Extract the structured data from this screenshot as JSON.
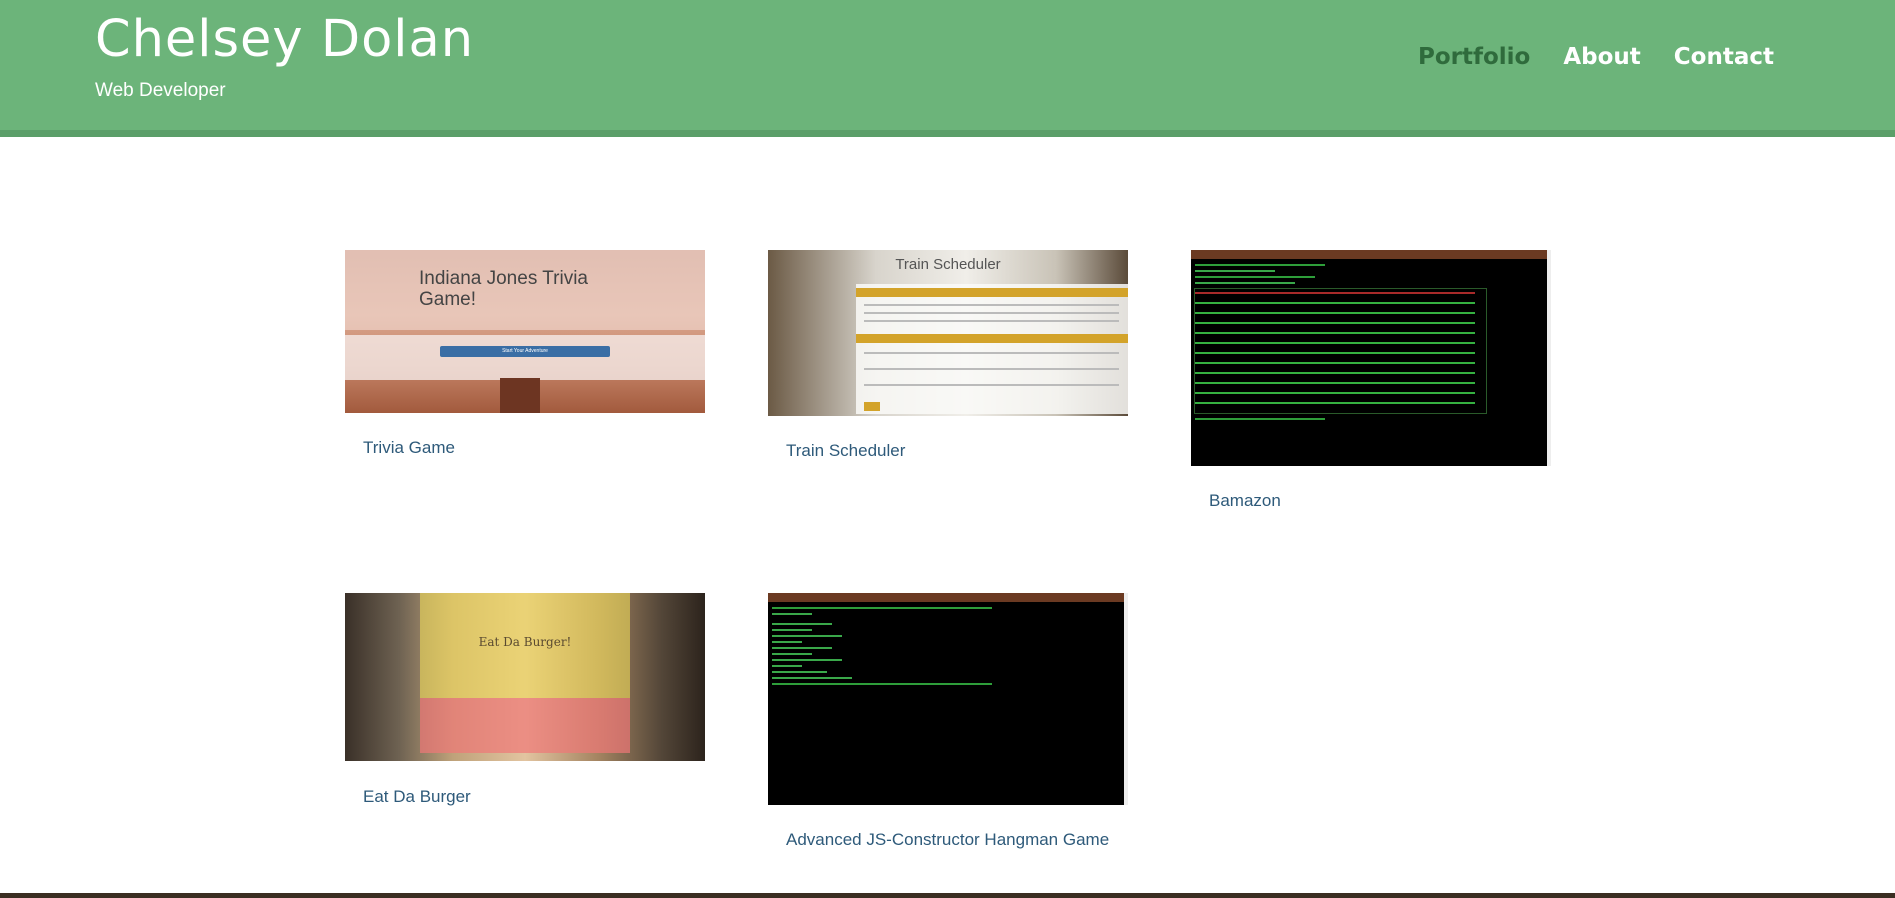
{
  "header": {
    "name": "Chelsey Dolan",
    "tagline": "Web Developer",
    "nav": [
      {
        "label": "Portfolio",
        "active": true
      },
      {
        "label": "About",
        "active": false
      },
      {
        "label": "Contact",
        "active": false
      }
    ]
  },
  "colors": {
    "header_bg": "#6cb47a",
    "header_border": "#5b9f69",
    "nav_active": "#2f6b3c",
    "link": "#2e5a7a"
  },
  "projects": [
    {
      "label": "Trivia Game",
      "screenshot": {
        "title": "Indiana Jones Trivia Game!",
        "button": "Start Your Adventure"
      }
    },
    {
      "label": "Train Scheduler",
      "screenshot": {
        "title": "Train Scheduler"
      }
    },
    {
      "label": "Bamazon",
      "screenshot": {
        "kind": "terminal"
      }
    },
    {
      "label": "Eat Da Burger",
      "screenshot": {
        "title": "Eat Da Burger!"
      }
    },
    {
      "label": "Advanced JS-Constructor Hangman Game",
      "screenshot": {
        "kind": "terminal"
      }
    }
  ]
}
